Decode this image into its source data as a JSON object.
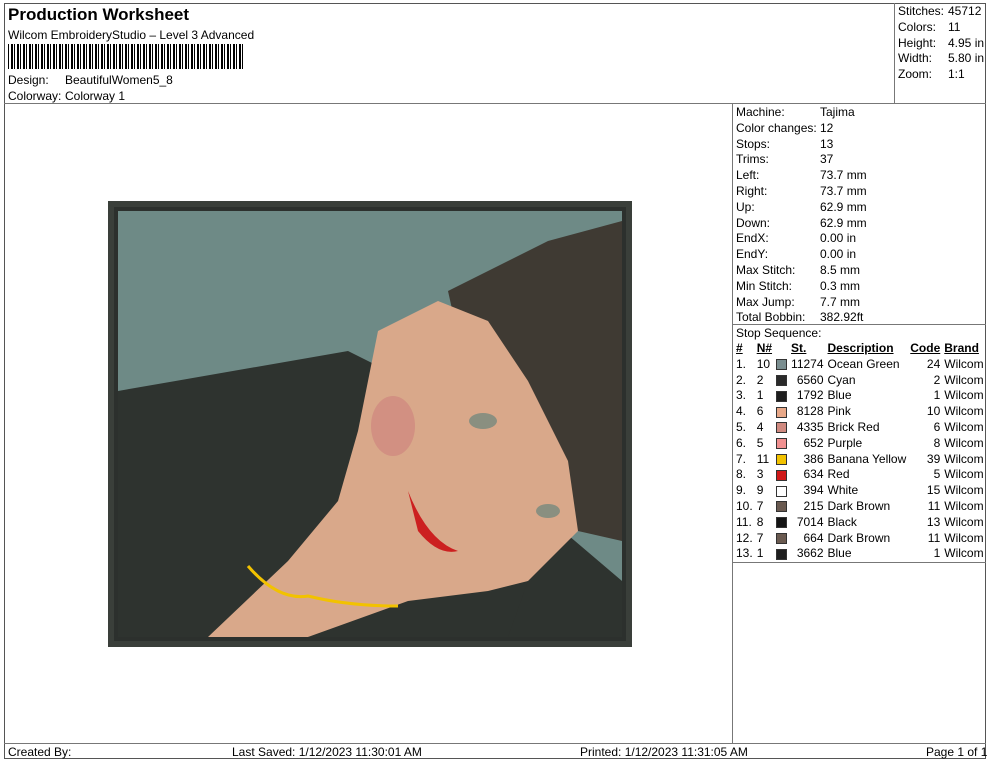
{
  "header": {
    "title": "Production Worksheet",
    "software": "Wilcom EmbroideryStudio – Level 3 Advanced",
    "design_label": "Design:",
    "design_value": "BeautifulWomen5_8",
    "colorway_label": "Colorway:",
    "colorway_value": "Colorway 1"
  },
  "stats": [
    {
      "label": "Stitches:",
      "value": "45712"
    },
    {
      "label": "Colors:",
      "value": "11"
    },
    {
      "label": "Height:",
      "value": "4.95 in"
    },
    {
      "label": "Width:",
      "value": "5.80 in"
    },
    {
      "label": "Zoom:",
      "value": "1:1"
    }
  ],
  "machine_info": [
    {
      "label": "Machine:",
      "value": "Tajima"
    },
    {
      "label": "Color changes:",
      "value": "12"
    },
    {
      "label": "Stops:",
      "value": "13"
    },
    {
      "label": "Trims:",
      "value": "37"
    },
    {
      "label": "Left:",
      "value": "73.7 mm"
    },
    {
      "label": "Right:",
      "value": "73.7 mm"
    },
    {
      "label": "Up:",
      "value": "62.9 mm"
    },
    {
      "label": "Down:",
      "value": "62.9 mm"
    },
    {
      "label": "EndX:",
      "value": "0.00 in"
    },
    {
      "label": "EndY:",
      "value": "0.00 in"
    },
    {
      "label": "Max Stitch:",
      "value": "8.5 mm"
    },
    {
      "label": "Min Stitch:",
      "value": "0.3 mm"
    },
    {
      "label": "Max Jump:",
      "value": "7.7 mm"
    },
    {
      "label": "Total Bobbin:",
      "value": "382.92ft"
    }
  ],
  "stop_sequence": {
    "title": "Stop Sequence:",
    "columns": [
      "#",
      "N#",
      "St.",
      "Description",
      "Code",
      "Brand"
    ],
    "rows": [
      {
        "num": "1.",
        "n": "10",
        "color": "#7a8e90",
        "st": "11274",
        "desc": "Ocean Green",
        "code": "24",
        "brand": "Wilcom"
      },
      {
        "num": "2.",
        "n": "2",
        "color": "#2a2a2a",
        "st": "6560",
        "desc": "Cyan",
        "code": "2",
        "brand": "Wilcom"
      },
      {
        "num": "3.",
        "n": "1",
        "color": "#1e1e1e",
        "st": "1792",
        "desc": "Blue",
        "code": "1",
        "brand": "Wilcom"
      },
      {
        "num": "4.",
        "n": "6",
        "color": "#e8a888",
        "st": "8128",
        "desc": "Pink",
        "code": "10",
        "brand": "Wilcom"
      },
      {
        "num": "5.",
        "n": "4",
        "color": "#d08a80",
        "st": "4335",
        "desc": "Brick Red",
        "code": "6",
        "brand": "Wilcom"
      },
      {
        "num": "6.",
        "n": "5",
        "color": "#f09090",
        "st": "652",
        "desc": "Purple",
        "code": "8",
        "brand": "Wilcom"
      },
      {
        "num": "7.",
        "n": "11",
        "color": "#f2c200",
        "st": "386",
        "desc": "Banana Yellow",
        "code": "39",
        "brand": "Wilcom"
      },
      {
        "num": "8.",
        "n": "3",
        "color": "#d01818",
        "st": "634",
        "desc": "Red",
        "code": "5",
        "brand": "Wilcom"
      },
      {
        "num": "9.",
        "n": "9",
        "color": "#ffffff",
        "st": "394",
        "desc": "White",
        "code": "15",
        "brand": "Wilcom"
      },
      {
        "num": "10.",
        "n": "7",
        "color": "#6a5a50",
        "st": "215",
        "desc": "Dark Brown",
        "code": "11",
        "brand": "Wilcom"
      },
      {
        "num": "11.",
        "n": "8",
        "color": "#141414",
        "st": "7014",
        "desc": "Black",
        "code": "13",
        "brand": "Wilcom"
      },
      {
        "num": "12.",
        "n": "7",
        "color": "#6a5a50",
        "st": "664",
        "desc": "Dark Brown",
        "code": "11",
        "brand": "Wilcom"
      },
      {
        "num": "13.",
        "n": "1",
        "color": "#1e1e1e",
        "st": "3662",
        "desc": "Blue",
        "code": "1",
        "brand": "Wilcom"
      }
    ]
  },
  "footer": {
    "created_by": "Created By:",
    "last_saved": "Last Saved: 1/12/2023 11:30:01 AM",
    "printed": "Printed: 1/12/2023 11:31:05 AM",
    "page": "Page 1 of 1"
  }
}
